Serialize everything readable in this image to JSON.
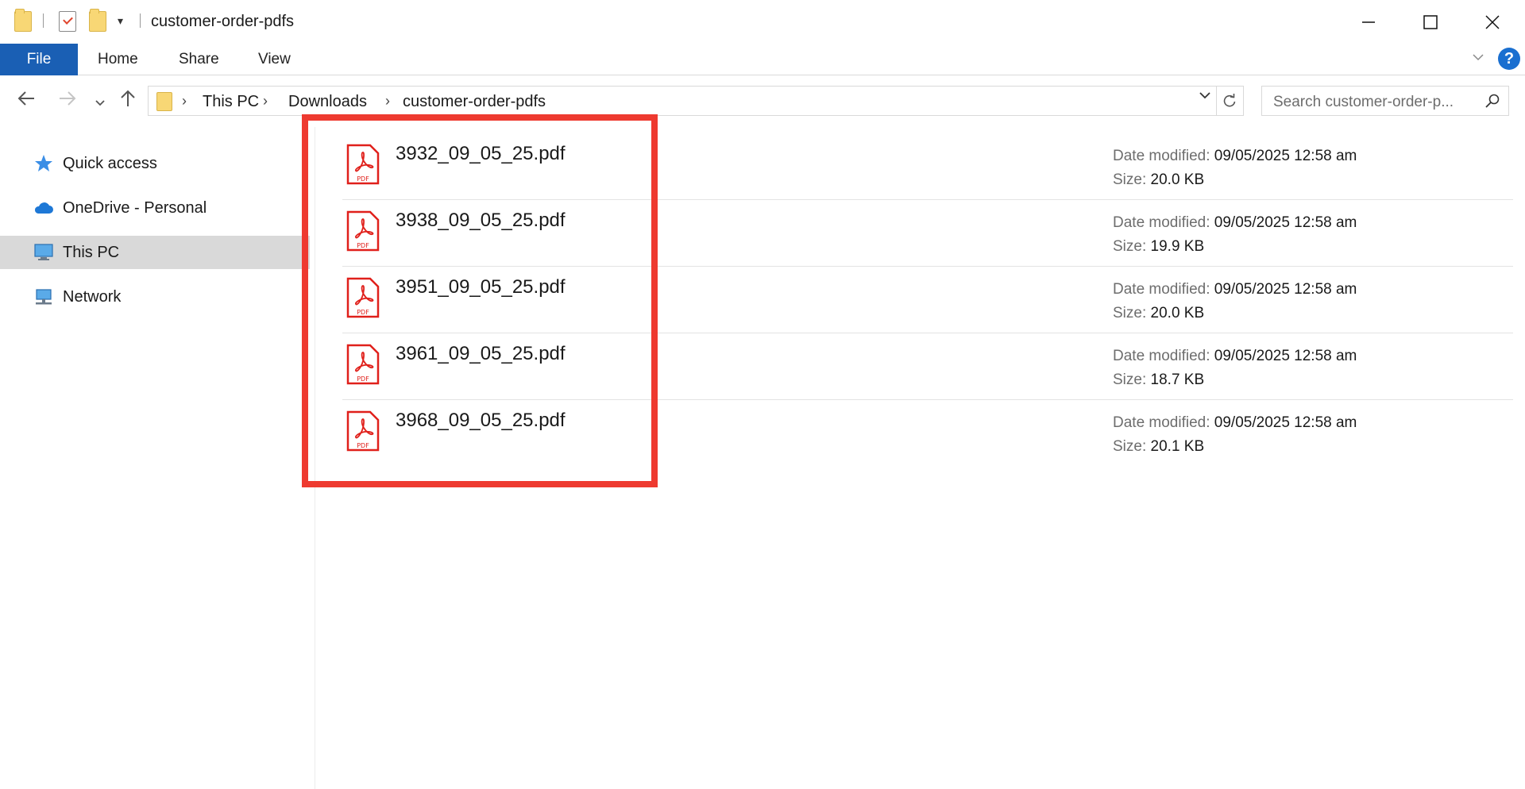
{
  "window": {
    "title": "customer-order-pdfs",
    "qa_dropdown_icon": "▾"
  },
  "ribbon": {
    "tabs": [
      {
        "label": "File"
      },
      {
        "label": "Home"
      },
      {
        "label": "Share"
      },
      {
        "label": "View"
      }
    ],
    "help_label": "?"
  },
  "address": {
    "crumbs": [
      "This PC",
      "Downloads",
      "customer-order-pdfs"
    ]
  },
  "search": {
    "placeholder": "Search customer-order-p..."
  },
  "navpane": {
    "items": [
      {
        "label": "Quick access",
        "icon": "star-icon"
      },
      {
        "label": "OneDrive - Personal",
        "icon": "cloud-icon"
      },
      {
        "label": "This PC",
        "icon": "computer-icon",
        "selected": true
      },
      {
        "label": "Network",
        "icon": "network-icon"
      }
    ]
  },
  "files": {
    "date_label": "Date modified:",
    "size_label": "Size:",
    "items": [
      {
        "name": "3932_09_05_25.pdf",
        "date": "09/05/2025 12:58 am",
        "size": "20.0 KB"
      },
      {
        "name": "3938_09_05_25.pdf",
        "date": "09/05/2025 12:58 am",
        "size": "19.9 KB"
      },
      {
        "name": "3951_09_05_25.pdf",
        "date": "09/05/2025 12:58 am",
        "size": "20.0 KB"
      },
      {
        "name": "3961_09_05_25.pdf",
        "date": "09/05/2025 12:58 am",
        "size": "18.7 KB"
      },
      {
        "name": "3968_09_05_25.pdf",
        "date": "09/05/2025 12:58 am",
        "size": "20.1 KB"
      }
    ]
  },
  "colors": {
    "file_tab": "#1a5fb4",
    "highlight": "#ee3a30",
    "pdf_red": "#e0201b"
  }
}
